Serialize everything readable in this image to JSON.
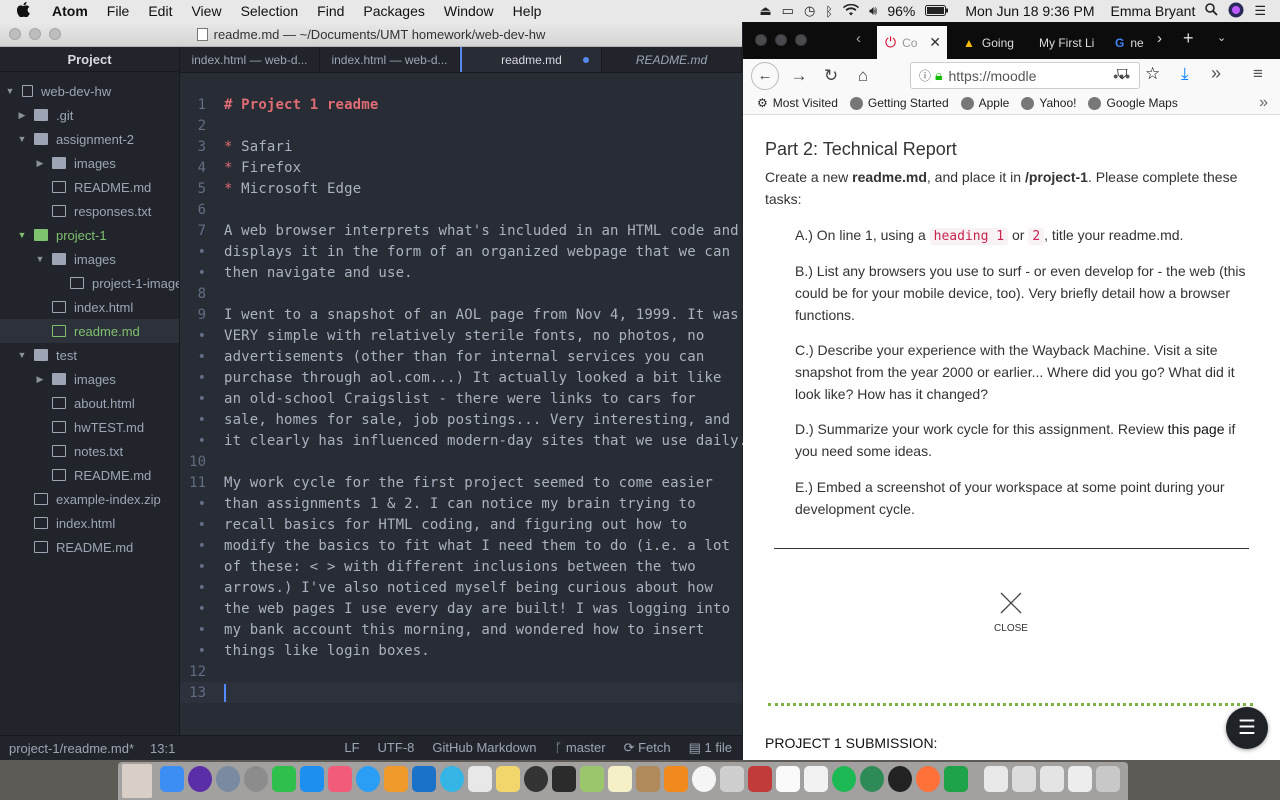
{
  "menubar": {
    "apple": "",
    "items": [
      "Atom",
      "File",
      "Edit",
      "View",
      "Selection",
      "Find",
      "Packages",
      "Window",
      "Help"
    ],
    "battery": "96%",
    "clock": "Mon Jun 18  9:36 PM",
    "user": "Emma Bryant"
  },
  "atom": {
    "window_title": "readme.md — ~/Documents/UMT homework/web-dev-hw",
    "tree_header": "Project",
    "tree": [
      {
        "label": "web-dev-hw",
        "type": "repo"
      },
      {
        "label": ".git",
        "type": "folder"
      },
      {
        "label": "assignment-2",
        "type": "folder"
      },
      {
        "label": "images",
        "type": "folder"
      },
      {
        "label": "README.md",
        "type": "md"
      },
      {
        "label": "responses.txt",
        "type": "file"
      },
      {
        "label": "project-1",
        "type": "folder"
      },
      {
        "label": "images",
        "type": "folder"
      },
      {
        "label": "project-1-image",
        "type": "image"
      },
      {
        "label": "index.html",
        "type": "file"
      },
      {
        "label": "readme.md",
        "type": "md"
      },
      {
        "label": "test",
        "type": "folder"
      },
      {
        "label": "images",
        "type": "folder"
      },
      {
        "label": "about.html",
        "type": "file"
      },
      {
        "label": "hwTEST.md",
        "type": "md"
      },
      {
        "label": "notes.txt",
        "type": "file"
      },
      {
        "label": "README.md",
        "type": "md"
      },
      {
        "label": "example-index.zip",
        "type": "zip"
      },
      {
        "label": "index.html",
        "type": "file"
      },
      {
        "label": "README.md",
        "type": "md"
      }
    ],
    "tabs": [
      "index.html — web-d...",
      "index.html — web-d...",
      "readme.md",
      "README.md"
    ],
    "lines": [
      {
        "n": "1",
        "t": "# Project 1 readme"
      },
      {
        "n": "2",
        "t": ""
      },
      {
        "n": "3",
        "t": "* Safari"
      },
      {
        "n": "4",
        "t": "* Firefox"
      },
      {
        "n": "5",
        "t": "* Microsoft Edge"
      },
      {
        "n": "6",
        "t": ""
      },
      {
        "n": "7",
        "t": "A web browser interprets what's included in an HTML code and"
      },
      {
        "n": "•",
        "t": "displays it in the form of an organized webpage that we can"
      },
      {
        "n": "•",
        "t": "then navigate and use."
      },
      {
        "n": "8",
        "t": ""
      },
      {
        "n": "9",
        "t": "I went to a snapshot of an AOL page from Nov 4, 1999. It was"
      },
      {
        "n": "•",
        "t": "VERY simple with relatively sterile fonts, no photos, no"
      },
      {
        "n": "•",
        "t": "advertisements (other than for internal services you can"
      },
      {
        "n": "•",
        "t": "purchase through aol.com...) It actually looked a bit like"
      },
      {
        "n": "•",
        "t": "an old-school Craigslist - there were links to cars for"
      },
      {
        "n": "•",
        "t": "sale, homes for sale, job postings... Very interesting, and"
      },
      {
        "n": "•",
        "t": "it clearly has influenced modern-day sites that we use daily."
      },
      {
        "n": "10",
        "t": ""
      },
      {
        "n": "11",
        "t": "My work cycle for the first project seemed to come easier"
      },
      {
        "n": "•",
        "t": "than assignments 1 & 2. I can notice my brain trying to"
      },
      {
        "n": "•",
        "t": "recall basics for HTML coding, and figuring out how to"
      },
      {
        "n": "•",
        "t": "modify the basics to fit what I need them to do (i.e. a lot"
      },
      {
        "n": "•",
        "t": "of these: < > with different inclusions between the two"
      },
      {
        "n": "•",
        "t": "arrows.) I've also noticed myself being curious about how"
      },
      {
        "n": "•",
        "t": "the web pages I use every day are built! I was logging into"
      },
      {
        "n": "•",
        "t": "my bank account this morning, and wondered how to insert"
      },
      {
        "n": "•",
        "t": "things like login boxes."
      },
      {
        "n": "12",
        "t": ""
      },
      {
        "n": "13",
        "t": ""
      }
    ],
    "status": {
      "path": "project-1/readme.md*",
      "pos": "13:1",
      "eol": "LF",
      "enc": "UTF-8",
      "grammar": "GitHub Markdown",
      "branch": "master",
      "fetch": "Fetch",
      "files": "1 file"
    }
  },
  "firefox": {
    "tabs": [
      "Co",
      "Going",
      "My First Li",
      "ne"
    ],
    "url": "https://moodle",
    "bookmarks": [
      "Most Visited",
      "Getting Started",
      "Apple",
      "Yahoo!",
      "Google Maps"
    ],
    "page": {
      "heading": "Part 2: Technical Report",
      "intro_a": "Create a new ",
      "intro_b": "readme.md",
      "intro_c": ", and place it in ",
      "intro_d": "/project-1",
      "intro_e": ". Please complete these tasks:",
      "task_a_1": "A.) On line 1, using a ",
      "task_a_code1": "heading 1",
      "task_a_or": " or ",
      "task_a_code2": "2",
      "task_a_2": ", title your readme.md.",
      "task_b": "B.) List any browsers you use to surf - or even develop for - the web (this could be for your mobile device, too). Very briefly detail how a browser functions.",
      "task_c": "C.) Describe your experience with the Wayback Machine. Visit a site snapshot from the year 2000 or earlier... Where did you go? What did it look like? How has it changed?",
      "task_d_1": "D.) Summarize your work cycle for this assignment. Review ",
      "task_d_link": "this page",
      "task_d_2": " if you need some ideas.",
      "task_e": "E.) Embed a screenshot of your workspace at some point during your development cycle.",
      "close": "CLOSE",
      "submission": "PROJECT 1 SUBMISSION:"
    }
  }
}
